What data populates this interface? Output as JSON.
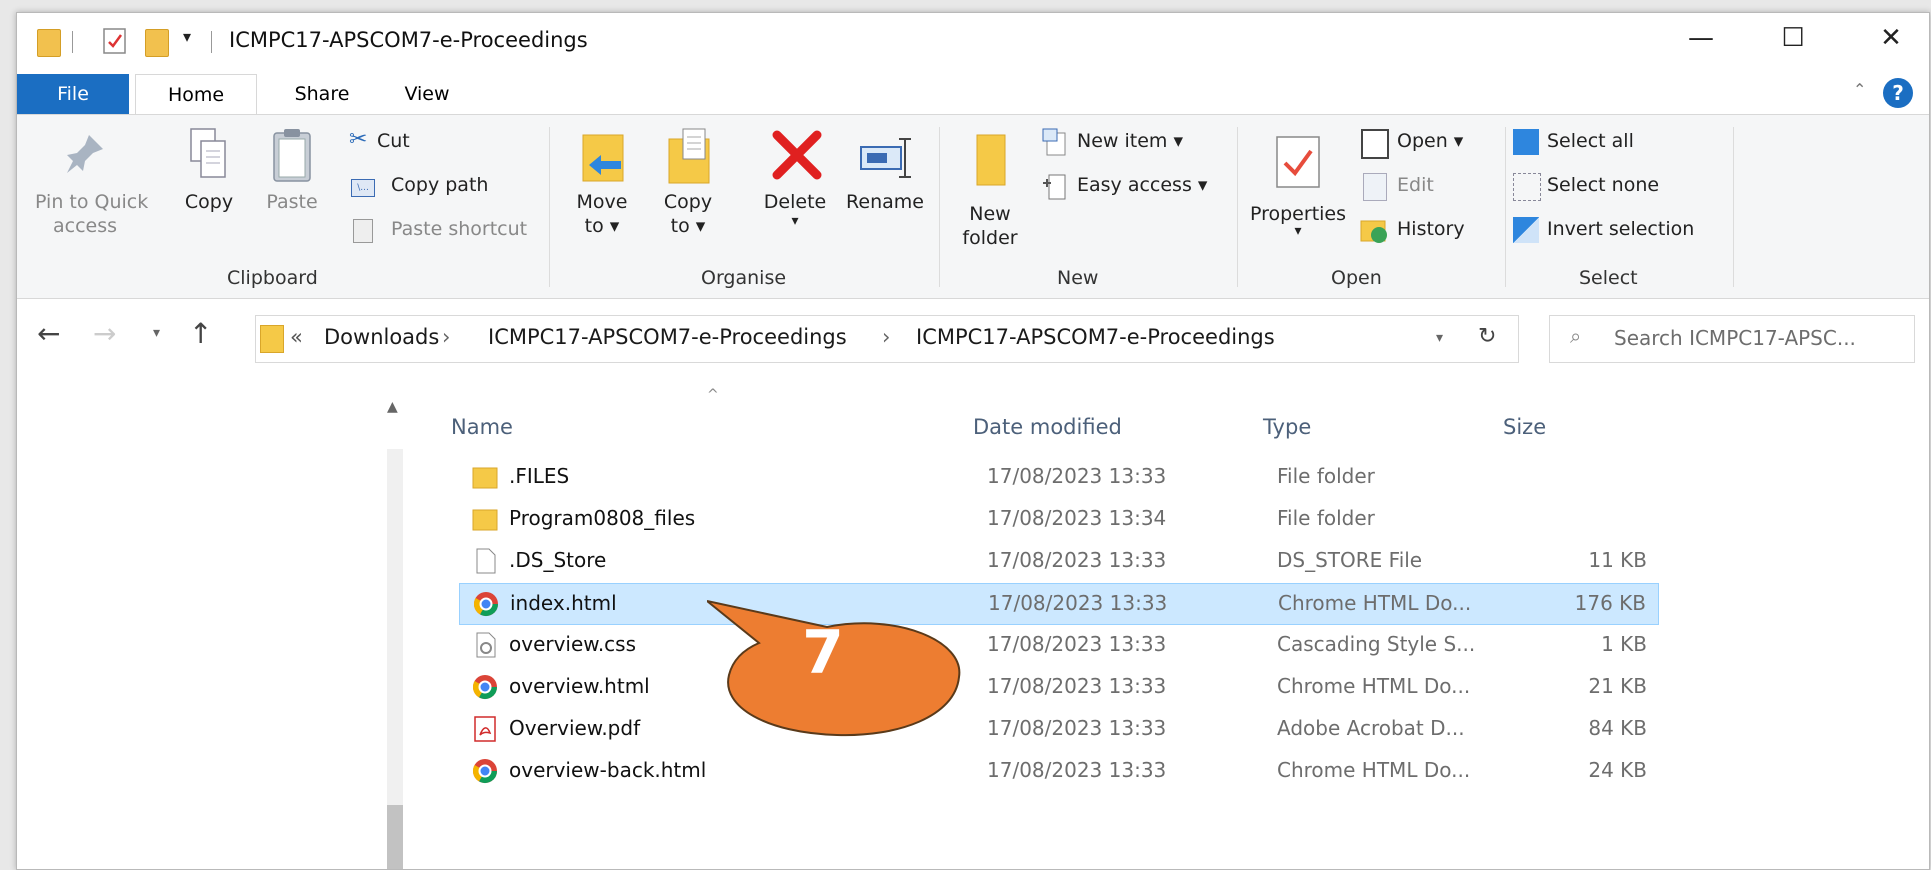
{
  "window": {
    "title": "ICMPC17-APSCOM7-e-Proceedings",
    "controls": {
      "minimize": "—",
      "maximize": "☐",
      "close": "✕"
    }
  },
  "ribbon_tabs": [
    "File",
    "Home",
    "Share",
    "View"
  ],
  "ribbon": {
    "clipboard": {
      "label": "Clipboard",
      "pin": "Pin to Quick access",
      "pin_line1": "Pin to Quick",
      "pin_line2": "access",
      "copy": "Copy",
      "paste": "Paste",
      "cut": "Cut",
      "copy_path": "Copy path",
      "paste_shortcut": "Paste shortcut"
    },
    "organise": {
      "label": "Organise",
      "move_to_1": "Move",
      "move_to_2": "to ▾",
      "copy_to_1": "Copy",
      "copy_to_2": "to ▾",
      "delete": "Delete",
      "delete_arrow": "▾",
      "rename": "Rename"
    },
    "new": {
      "label": "New",
      "new_folder_1": "New",
      "new_folder_2": "folder",
      "new_item": "New item ▾",
      "easy_access": "Easy access ▾"
    },
    "open": {
      "label": "Open",
      "properties": "Properties",
      "properties_arrow": "▾",
      "open": "Open ▾",
      "edit": "Edit",
      "history": "History"
    },
    "select": {
      "label": "Select",
      "select_all": "Select all",
      "select_none": "Select none",
      "invert": "Invert selection"
    }
  },
  "address": {
    "overflow": "«",
    "crumbs": [
      "Downloads",
      "ICMPC17-APSCOM7-e-Proceedings",
      "ICMPC17-APSCOM7-e-Proceedings"
    ],
    "separator": "›",
    "search_placeholder": "Search ICMPC17-APSC..."
  },
  "columns": {
    "name": "Name",
    "date": "Date modified",
    "type": "Type",
    "size": "Size"
  },
  "files": [
    {
      "name": ".FILES",
      "date": "17/08/2023 13:33",
      "type": "File folder",
      "size": "",
      "icon": "folder-icon"
    },
    {
      "name": "Program0808_files",
      "date": "17/08/2023 13:34",
      "type": "File folder",
      "size": "",
      "icon": "folder-icon"
    },
    {
      "name": ".DS_Store",
      "date": "17/08/2023 13:33",
      "type": "DS_STORE File",
      "size": "11 KB",
      "icon": "blank-file-icon"
    },
    {
      "name": "index.html",
      "date": "17/08/2023 13:33",
      "type": "Chrome HTML Do...",
      "size": "176 KB",
      "icon": "chrome-icon",
      "selected": true
    },
    {
      "name": "overview.css",
      "date": "17/08/2023 13:33",
      "type": "Cascading Style S...",
      "size": "1 KB",
      "icon": "css-file-icon"
    },
    {
      "name": "overview.html",
      "date": "17/08/2023 13:33",
      "type": "Chrome HTML Do...",
      "size": "21 KB",
      "icon": "chrome-icon"
    },
    {
      "name": "Overview.pdf",
      "date": "17/08/2023 13:33",
      "type": "Adobe Acrobat D...",
      "size": "84 KB",
      "icon": "pdf-icon"
    },
    {
      "name": "overview-back.html",
      "date": "17/08/2023 13:33",
      "type": "Chrome HTML Do...",
      "size": "24 KB",
      "icon": "chrome-icon"
    }
  ],
  "callout": {
    "number": "7",
    "color": "#ed7d31"
  },
  "colors": {
    "accent": "#1b6ec2",
    "selection": "#cce8ff",
    "folder": "#f2c14e"
  }
}
